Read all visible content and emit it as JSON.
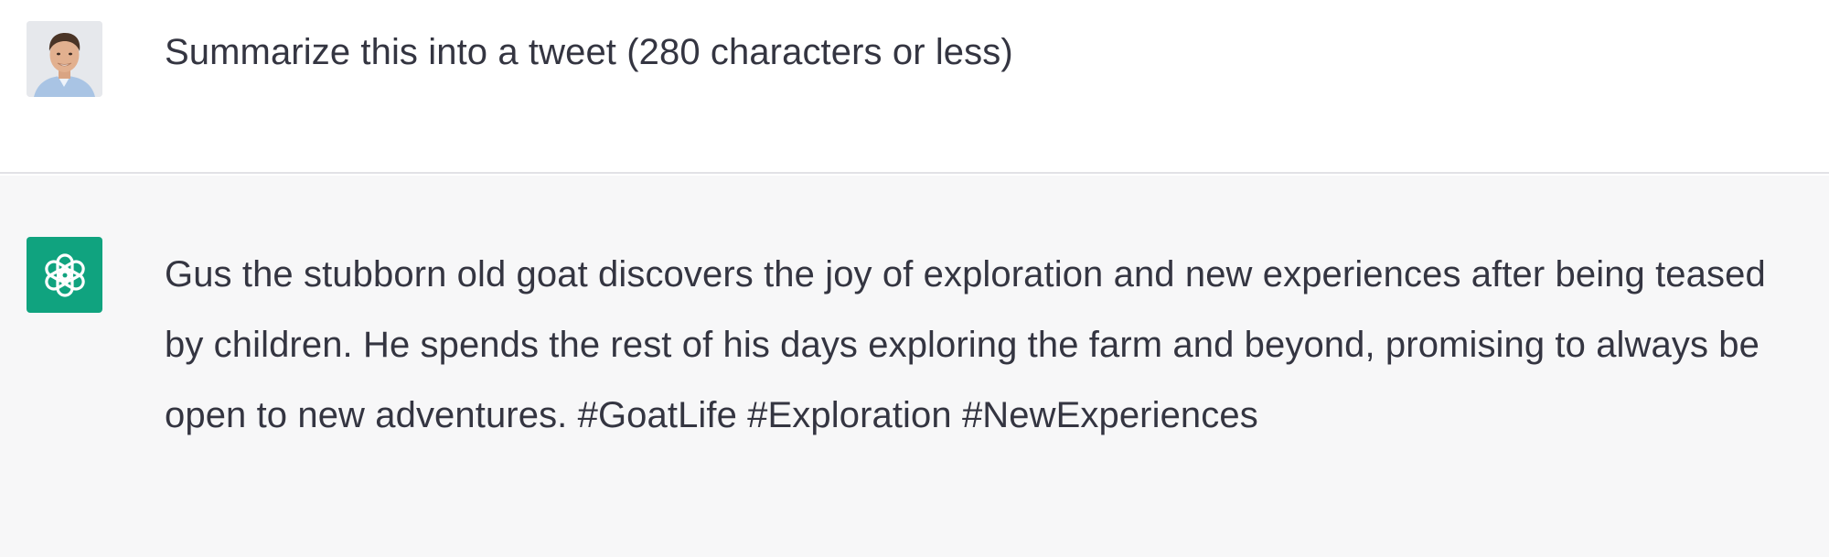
{
  "conversation": {
    "user_message": {
      "avatar_icon": "user-photo-avatar",
      "text": "Summarize this into a tweet (280 characters or less)"
    },
    "assistant_message": {
      "avatar_icon": "openai-logo-icon",
      "avatar_color": "#10a37f",
      "text": "Gus the stubborn old goat discovers the joy of exploration and new experiences after being teased by children. He spends the rest of his days exploring the farm and beyond, promising to always be open to new adventures. #GoatLife #Exploration #NewExperiences"
    }
  }
}
